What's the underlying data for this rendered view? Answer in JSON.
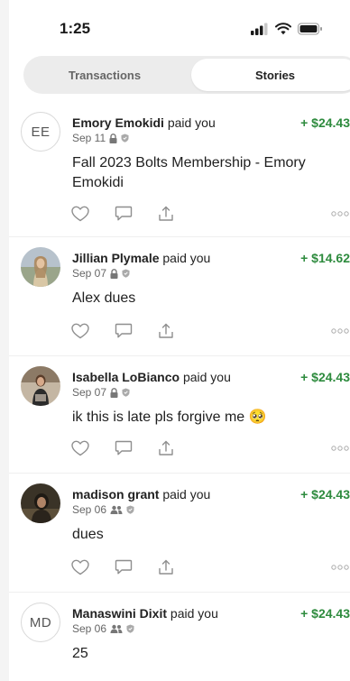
{
  "status_bar": {
    "time": "1:25"
  },
  "tabs": [
    {
      "label": "Transactions",
      "selected": false
    },
    {
      "label": "Stories",
      "selected": true
    }
  ],
  "stories": [
    {
      "avatar": {
        "type": "initials",
        "initials": "EE"
      },
      "payer": "Emory Emokidi",
      "action": "paid you",
      "amount": "+ $24.43",
      "date": "Sep 11",
      "audience_icon": "lock-icon",
      "note": "Fall 2023 Bolts Membership - Emory Emokidi"
    },
    {
      "avatar": {
        "type": "photo"
      },
      "payer": "Jillian Plymale",
      "action": "paid you",
      "amount": "+ $14.62",
      "date": "Sep 07",
      "audience_icon": "lock-icon",
      "note": "Alex dues"
    },
    {
      "avatar": {
        "type": "photo"
      },
      "payer": "Isabella LoBianco",
      "action": "paid you",
      "amount": "+ $24.43",
      "date": "Sep 07",
      "audience_icon": "lock-icon",
      "note": "ik this is late pls forgive me 🥺"
    },
    {
      "avatar": {
        "type": "photo"
      },
      "payer": "madison grant",
      "action": "paid you",
      "amount": "+ $24.43",
      "date": "Sep 06",
      "audience_icon": "friends-icon",
      "note": "dues"
    },
    {
      "avatar": {
        "type": "initials",
        "initials": "MD"
      },
      "payer": "Manaswini Dixit",
      "action": "paid you",
      "amount": "+ $24.43",
      "date": "Sep 06",
      "audience_icon": "friends-icon",
      "note": "25"
    }
  ],
  "colors": {
    "amount_green": "#2e8b3e",
    "icon_gray": "#9a9a9a"
  }
}
